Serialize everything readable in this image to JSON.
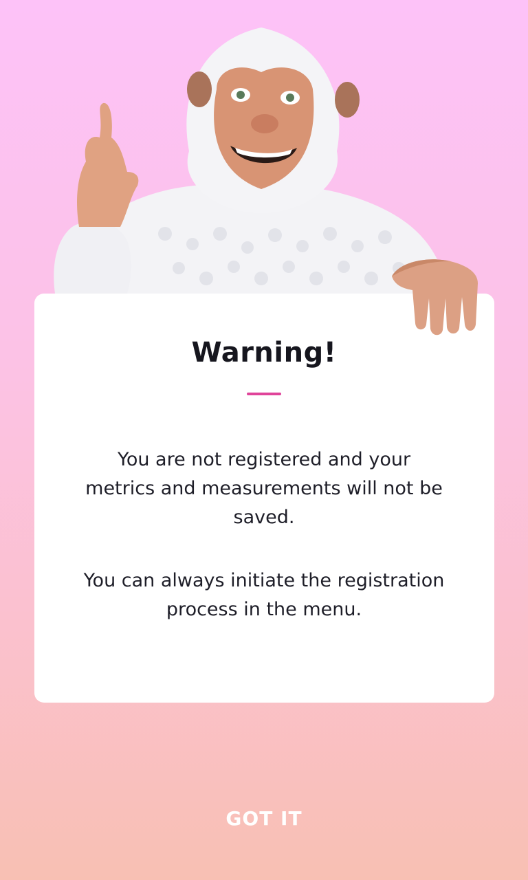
{
  "dialog": {
    "title": "Warning!",
    "paragraph_1": "You are not registered and your metrics and measurements will not be saved.",
    "paragraph_2": "You can always initiate the registration process in the menu."
  },
  "actions": {
    "confirm_label": "GOT IT"
  },
  "colors": {
    "background_top": "#fdc2f8",
    "background_bottom": "#f8c0b3",
    "accent": "#e0449a",
    "card": "#ffffff"
  }
}
